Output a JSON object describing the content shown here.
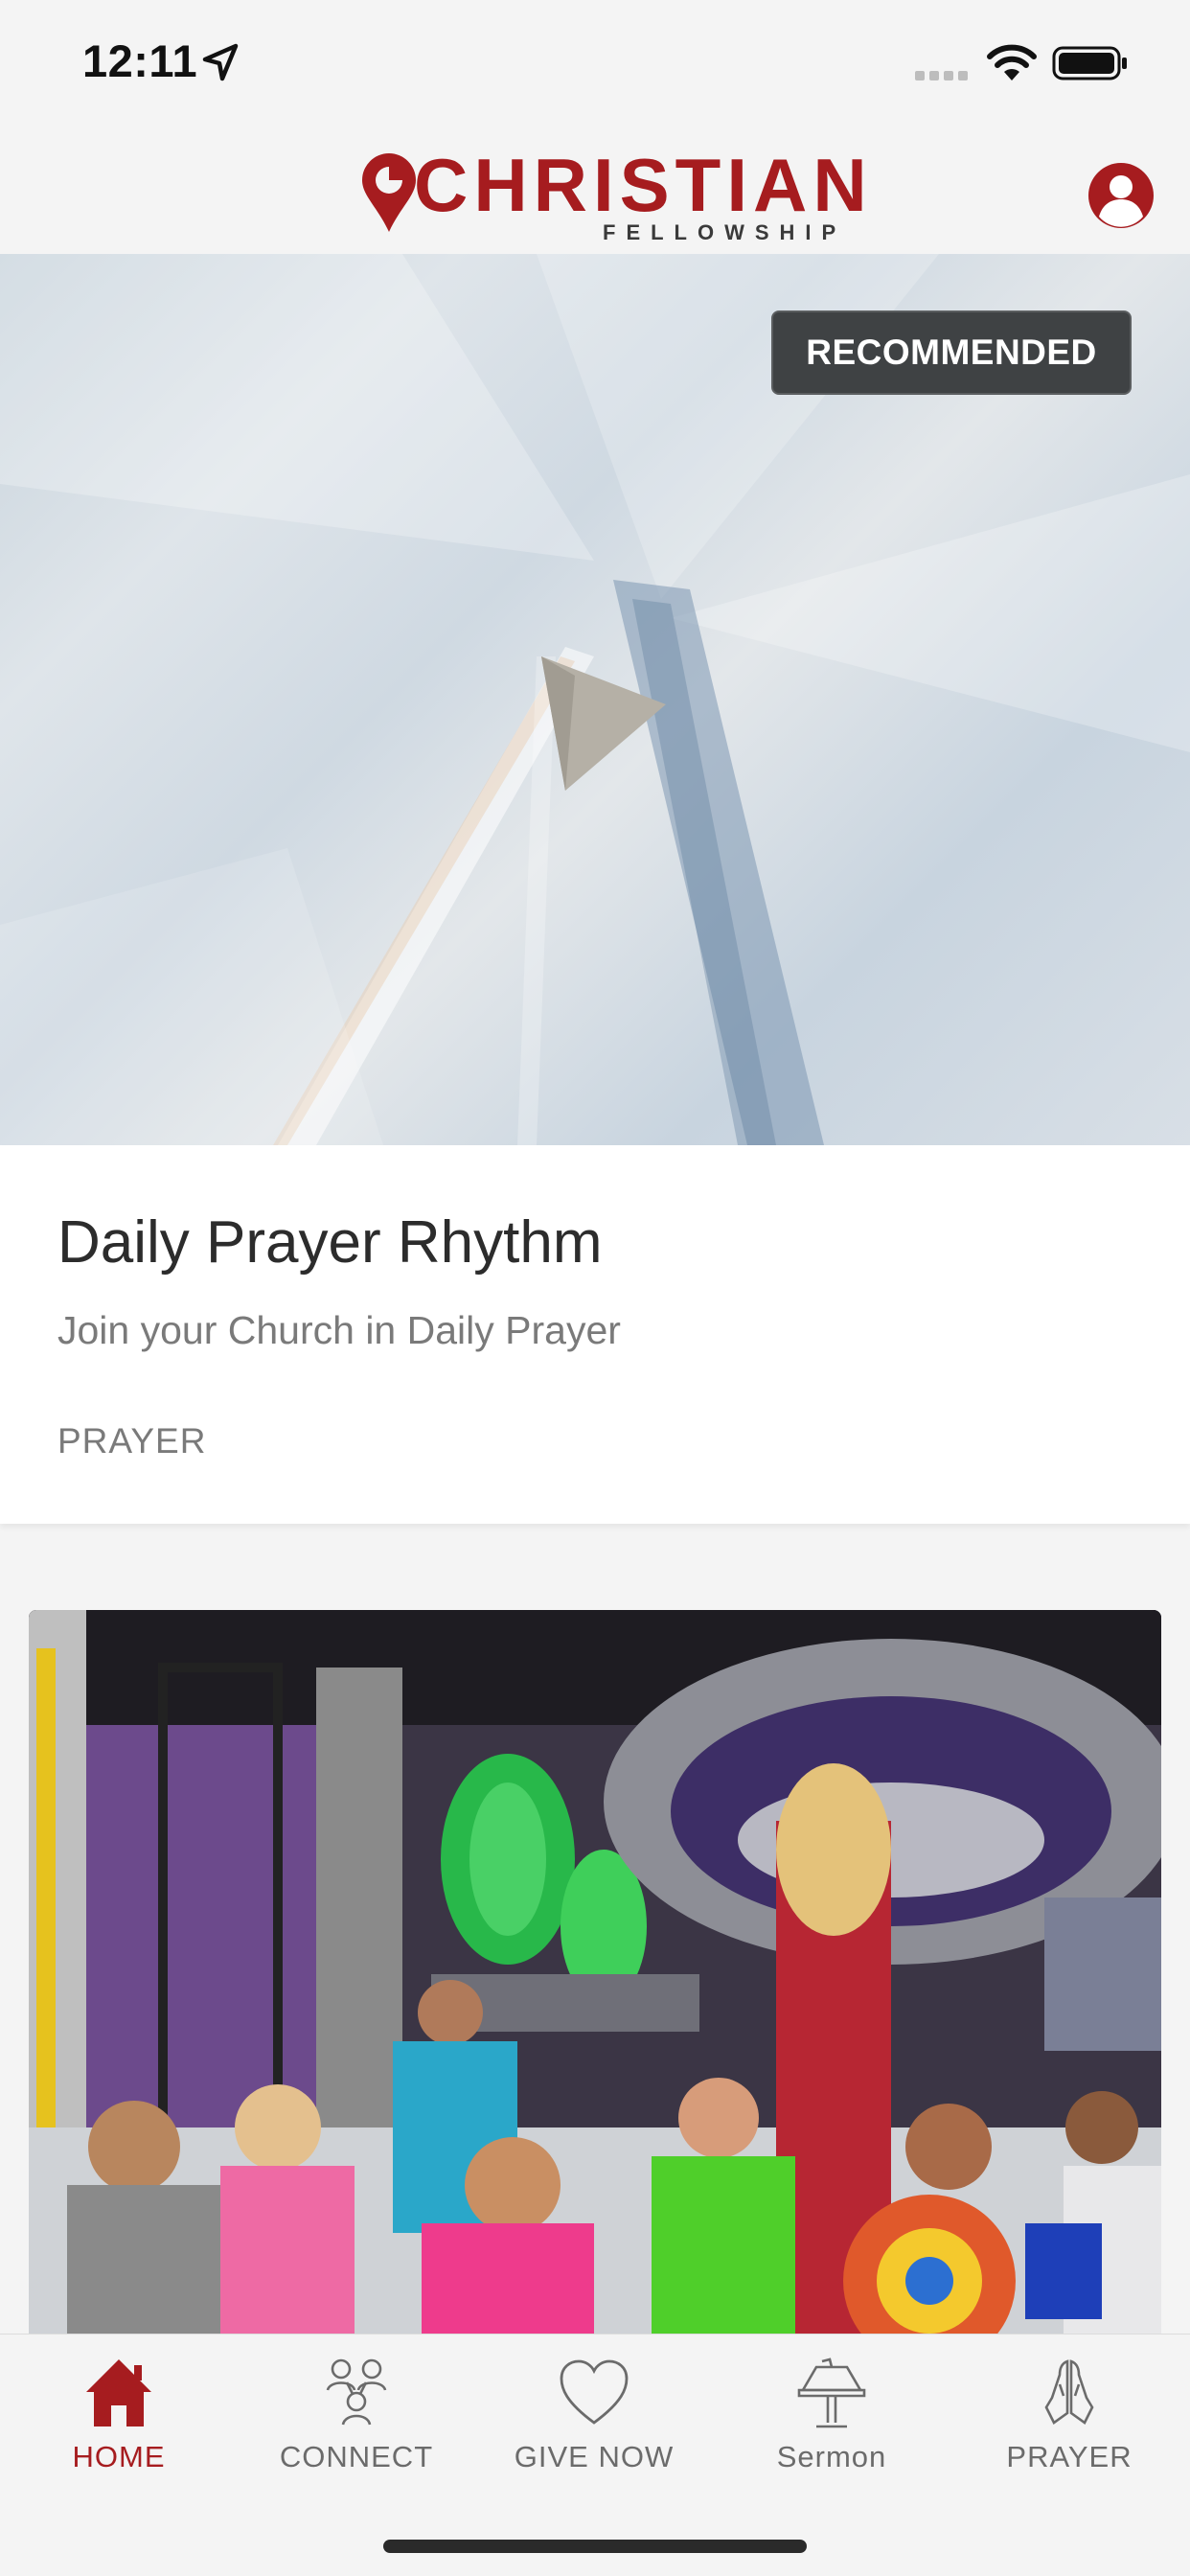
{
  "status_bar": {
    "time": "12:11",
    "icons": [
      "location-arrow-icon",
      "signal-dots-icon",
      "wifi-icon",
      "battery-icon"
    ]
  },
  "header": {
    "logo_main": "CHRISTIAN",
    "logo_sub": "FELLOWSHIP",
    "profile_icon": "user-circle-icon"
  },
  "featured": {
    "badge": "RECOMMENDED",
    "title": "Daily Prayer Rhythm",
    "subtitle": "Join your Church in Daily Prayer",
    "category": "PRAYER"
  },
  "tabs": [
    {
      "label": "HOME",
      "icon": "home-icon",
      "active": true
    },
    {
      "label": "CONNECT",
      "icon": "people-group-icon",
      "active": false
    },
    {
      "label": "GIVE NOW",
      "icon": "heart-icon",
      "active": false
    },
    {
      "label": "Sermon",
      "icon": "lectern-icon",
      "active": false
    },
    {
      "label": "PRAYER",
      "icon": "praying-hands-icon",
      "active": false
    }
  ],
  "colors": {
    "brand_red": "#a61c1f",
    "tab_inactive": "#6b6b6b",
    "badge_bg": "#3f4244"
  }
}
